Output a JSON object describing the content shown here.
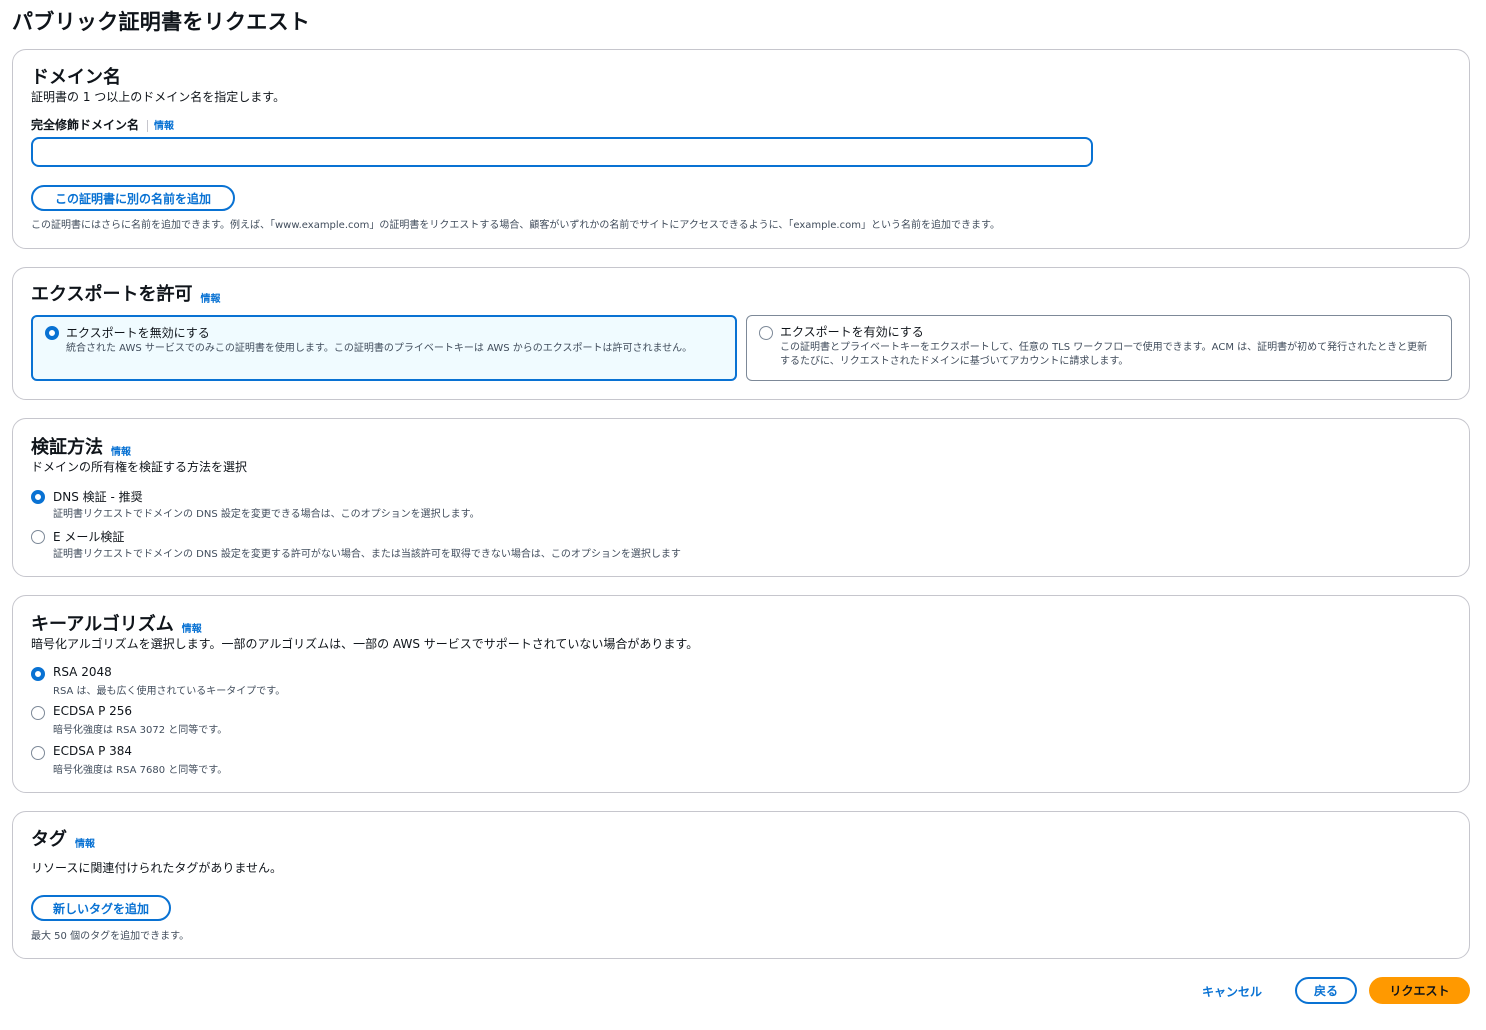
{
  "page": {
    "title": "パブリック証明書をリクエスト"
  },
  "domain_panel": {
    "title": "ドメイン名",
    "description": "証明書の 1 つ以上のドメイン名を指定します。",
    "field_label": "完全修飾ドメイン名",
    "info": "情報",
    "input_value": "",
    "add_name_button": "この証明書に別の名前を追加",
    "hint": "この証明書にはさらに名前を追加できます。例えば、「www.example.com」の証明書をリクエストする場合、顧客がいずれかの名前でサイトにアクセスできるように、「example.com」という名前を追加できます。"
  },
  "export_panel": {
    "title": "エクスポートを許可",
    "info": "情報",
    "options": [
      {
        "label": "エクスポートを無効にする",
        "description": "統合された AWS サービスでのみこの証明書を使用します。この証明書のプライベートキーは AWS からのエクスポートは許可されません。",
        "selected": true
      },
      {
        "label": "エクスポートを有効にする",
        "description": "この証明書とプライベートキーをエクスポートして、任意の TLS ワークフローで使用できます。ACM は、証明書が初めて発行されたときと更新するたびに、リクエストされたドメインに基づいてアカウントに請求します。",
        "selected": false
      }
    ]
  },
  "validation_panel": {
    "title": "検証方法",
    "info": "情報",
    "description": "ドメインの所有権を検証する方法を選択",
    "options": [
      {
        "label": "DNS 検証 - 推奨",
        "description": "証明書リクエストでドメインの DNS 設定を変更できる場合は、このオプションを選択します。",
        "selected": true
      },
      {
        "label": "E メール検証",
        "description": "証明書リクエストでドメインの DNS 設定を変更する許可がない場合、または当該許可を取得できない場合は、このオプションを選択します",
        "selected": false
      }
    ]
  },
  "key_panel": {
    "title": "キーアルゴリズム",
    "info": "情報",
    "description": "暗号化アルゴリズムを選択します。一部のアルゴリズムは、一部の AWS サービスでサポートされていない場合があります。",
    "options": [
      {
        "label": "RSA 2048",
        "description": "RSA は、最も広く使用されているキータイプです。",
        "selected": true
      },
      {
        "label": "ECDSA P 256",
        "description": "暗号化強度は RSA 3072 と同等です。",
        "selected": false
      },
      {
        "label": "ECDSA P 384",
        "description": "暗号化強度は RSA 7680 と同等です。",
        "selected": false
      }
    ]
  },
  "tags_panel": {
    "title": "タグ",
    "info": "情報",
    "empty_text": "リソースに関連付けられたタグがありません。",
    "add_tag_button": "新しいタグを追加",
    "limit_text": "最大 50 個のタグを追加できます。"
  },
  "footer": {
    "cancel": "キャンセル",
    "back": "戻る",
    "request": "リクエスト"
  },
  "colors": {
    "accent": "#0972d3",
    "primary_button": "#ff9900",
    "border": "#c6c6cd"
  }
}
